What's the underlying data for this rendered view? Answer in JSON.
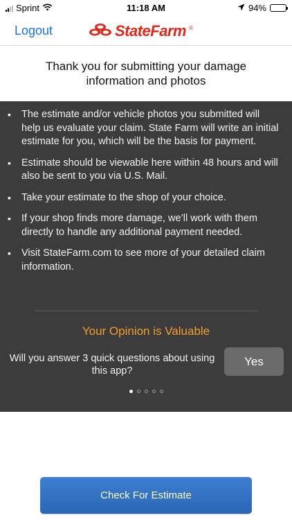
{
  "status_bar": {
    "carrier": "Sprint",
    "time": "11:18 AM",
    "battery": "94%",
    "battery_level": 0.94
  },
  "nav": {
    "logout_label": "Logout",
    "brand_name": "StateFarm",
    "brand_reg": "®",
    "brand_color": "#e0281a",
    "link_color": "#1a74d9"
  },
  "heading": {
    "text": "Thank you for submitting your damage information and photos"
  },
  "info": {
    "items": [
      "The estimate and/or vehicle photos you submitted will help us evaluate your claim. State Farm will write an initial estimate for you, which will be the basis for payment.",
      "Estimate should be viewable here within 48 hours and will also be sent to you via U.S. Mail.",
      "Take your estimate to the shop of your choice.",
      "If your shop finds more damage, we’ll work with them directly to handle any additional payment needed.",
      "Visit StateFarm.com to see more of your detailed claim information."
    ],
    "bullet": "▪"
  },
  "survey": {
    "title": "Your Opinion is Valuable",
    "question": "Will you answer 3 quick questions about using this app?",
    "yes_label": "Yes",
    "page_count": 5,
    "active_page": 1,
    "title_color": "#f0a030"
  },
  "footer": {
    "check_label": "Check For Estimate"
  }
}
